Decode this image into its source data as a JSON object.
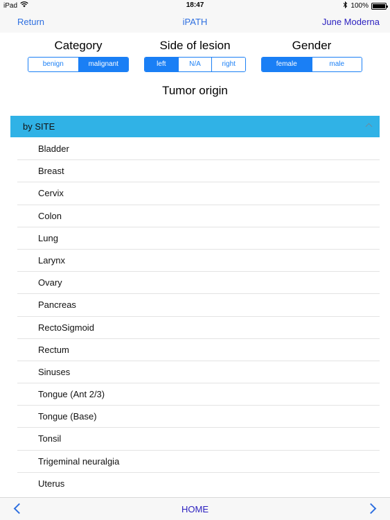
{
  "status": {
    "device": "iPad",
    "time": "18:47",
    "battery": "100%",
    "battery_level": 1.0,
    "icons": [
      "wifi-icon",
      "bluetooth-icon",
      "battery-icon"
    ]
  },
  "nav": {
    "left": "Return",
    "title": "iPATH",
    "right": "June Moderna"
  },
  "filters": {
    "category": {
      "title": "Category",
      "options": [
        "benign",
        "malignant"
      ],
      "selected": "malignant"
    },
    "side": {
      "title": "Side of lesion",
      "options": [
        "left",
        "N/A",
        "right"
      ],
      "selected": "left"
    },
    "gender": {
      "title": "Gender",
      "options": [
        "female",
        "male"
      ],
      "selected": "female"
    }
  },
  "section_title": "Tumor origin",
  "list": {
    "header": "by SITE",
    "items": [
      "Bladder",
      "Breast",
      "Cervix",
      "Colon",
      "Lung",
      "Larynx",
      "Ovary",
      "Pancreas",
      "RectoSigmoid",
      "Rectum",
      "Sinuses",
      "Tongue (Ant 2/3)",
      "Tongue (Base)",
      "Tonsil",
      "Trigeminal neuralgia",
      "Uterus"
    ]
  },
  "bottom": {
    "home": "HOME"
  },
  "colors": {
    "accent": "#1a7ff5",
    "header_bg": "#30b2e6",
    "nav_text": "#2e6fe0"
  }
}
